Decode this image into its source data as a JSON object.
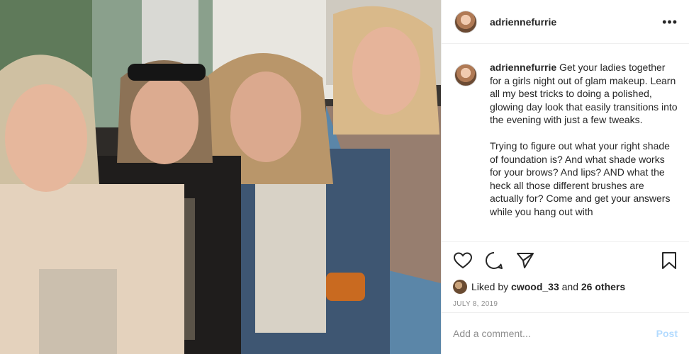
{
  "post": {
    "username": "adriennefurrie",
    "caption": {
      "username": "adriennefurrie",
      "text": "Get your ladies together for a girls night out of glam makeup. Learn all my best tricks to doing a polished, glowing day look that easily transitions into the evening with just a few tweaks.\n\nTrying to figure out what your right shade of foundation is? And what shade works for your brows? And lips? AND what the heck all those different brushes are actually for? Come and get your answers while you hang out with"
    },
    "likes": {
      "prefix": "Liked by",
      "user": "cwood_33",
      "conjunction": "and",
      "others": "26 others"
    },
    "date": "JULY 8, 2019",
    "comment": {
      "placeholder": "Add a comment...",
      "post_label": "Post"
    }
  },
  "icons": {
    "more": "more-options-icon",
    "like": "heart-icon",
    "comment": "comment-bubble-icon",
    "share": "paper-plane-icon",
    "save": "bookmark-icon"
  },
  "colors": {
    "text": "#262626",
    "muted": "#8e8e8e",
    "post_button": "#b3dbff",
    "border": "#efefef"
  }
}
